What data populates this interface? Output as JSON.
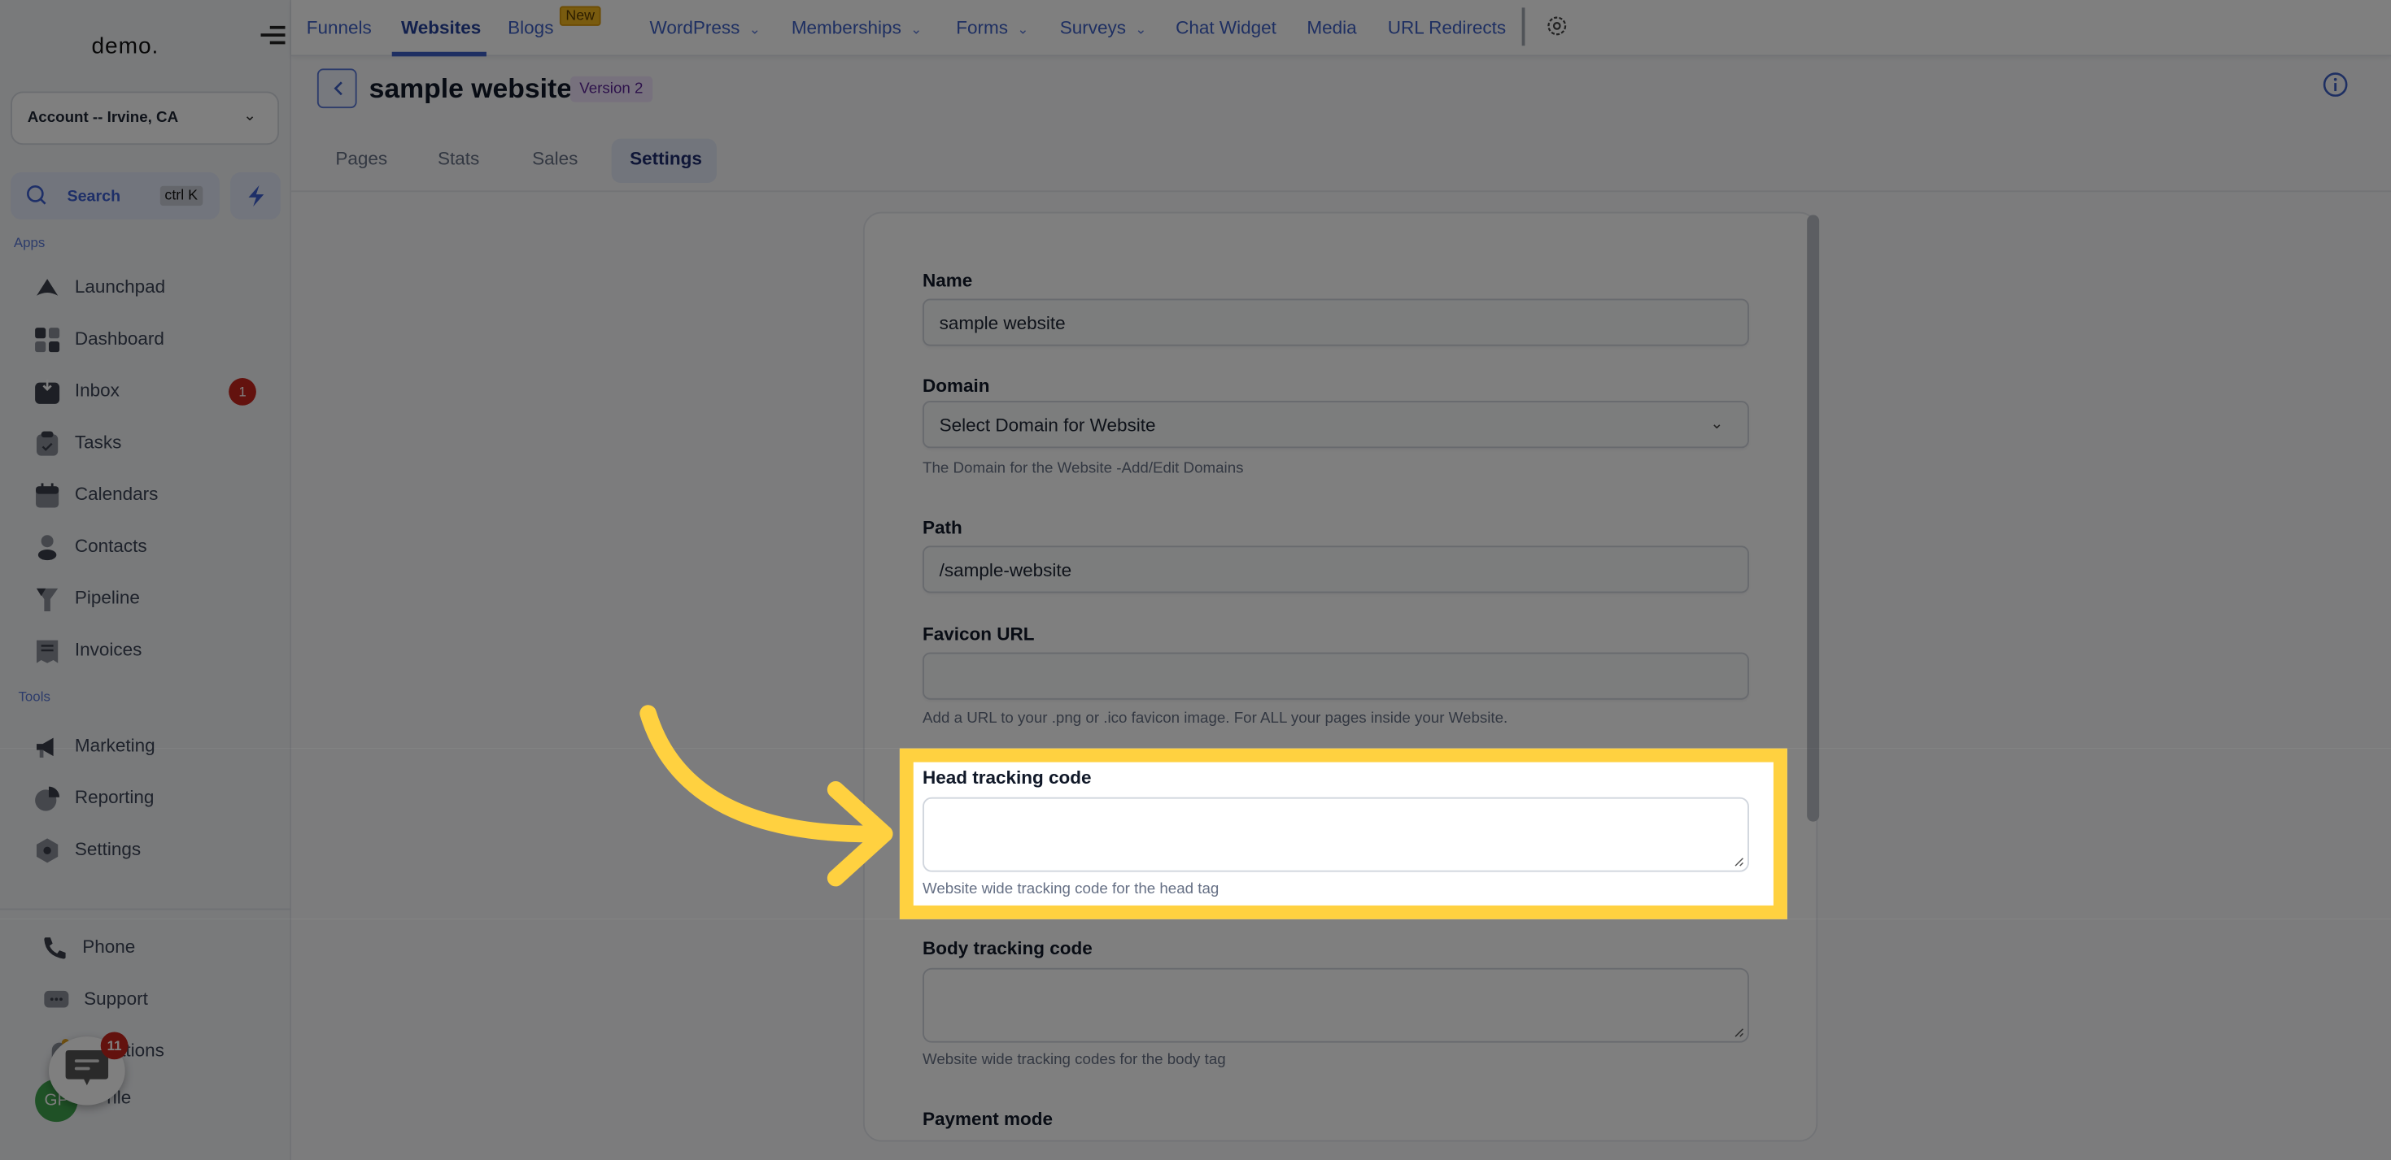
{
  "sidebar": {
    "logo": "demo.",
    "account": "Account -- Irvine, CA",
    "search_label": "Search",
    "search_shortcut": "ctrl K",
    "sections": {
      "apps": "Apps",
      "tools": "Tools"
    },
    "apps": [
      {
        "label": "Launchpad",
        "icon": "rocket-icon"
      },
      {
        "label": "Dashboard",
        "icon": "dashboard-grid-icon"
      },
      {
        "label": "Inbox",
        "icon": "inbox-icon",
        "badge": "1"
      },
      {
        "label": "Tasks",
        "icon": "clipboard-check-icon"
      },
      {
        "label": "Calendars",
        "icon": "calendar-icon"
      },
      {
        "label": "Contacts",
        "icon": "person-icon"
      },
      {
        "label": "Pipeline",
        "icon": "funnel-icon"
      },
      {
        "label": "Invoices",
        "icon": "invoice-icon"
      }
    ],
    "tools": [
      {
        "label": "Marketing",
        "icon": "megaphone-icon"
      },
      {
        "label": "Reporting",
        "icon": "pie-chart-icon"
      },
      {
        "label": "Settings",
        "icon": "settings-hex-icon"
      }
    ],
    "bottom": [
      {
        "label": "Phone",
        "icon": "phone-icon"
      },
      {
        "label": "Support",
        "icon": "chat-bubble-icon"
      },
      {
        "label": "Notifications",
        "visible_text": "ications",
        "icon": "bell-icon"
      },
      {
        "label": "Profile",
        "visible_text": "rile",
        "icon": "avatar"
      }
    ],
    "avatar_initials": "GP",
    "chat_fab_badge": "11"
  },
  "topnav": {
    "items": [
      {
        "label": "Funnels"
      },
      {
        "label": "Websites",
        "active": true
      },
      {
        "label": "Blogs",
        "badge": "New"
      },
      {
        "label": "WordPress",
        "dropdown": true
      },
      {
        "label": "Memberships",
        "dropdown": true
      },
      {
        "label": "Forms",
        "dropdown": true
      },
      {
        "label": "Surveys",
        "dropdown": true
      },
      {
        "label": "Chat Widget"
      },
      {
        "label": "Media"
      },
      {
        "label": "URL Redirects"
      }
    ]
  },
  "page": {
    "title": "sample website",
    "version_badge": "Version 2",
    "tabs": [
      "Pages",
      "Stats",
      "Sales",
      "Settings"
    ],
    "active_tab": "Settings"
  },
  "form": {
    "name": {
      "label": "Name",
      "value": "sample website"
    },
    "domain": {
      "label": "Domain",
      "value": "Select Domain for Website",
      "help": "The Domain for the Website -Add/Edit Domains"
    },
    "path": {
      "label": "Path",
      "value": "/sample-website"
    },
    "favicon": {
      "label": "Favicon URL",
      "value": "",
      "help": "Add a URL to your .png or .ico favicon image. For ALL your pages inside your Website."
    },
    "head_tracking": {
      "label": "Head tracking code",
      "value": "",
      "help": "Website wide tracking code for the head tag"
    },
    "body_tracking": {
      "label": "Body tracking code",
      "value": "",
      "help": "Website wide tracking codes for the body tag"
    },
    "payment_mode": {
      "label": "Payment mode"
    }
  },
  "colors": {
    "accent": "#3d5fc4",
    "highlight": "#ffd140",
    "badge_red": "#c7241d",
    "version_badge_bg": "#efe3fb",
    "new_badge": "#f2b61f"
  }
}
